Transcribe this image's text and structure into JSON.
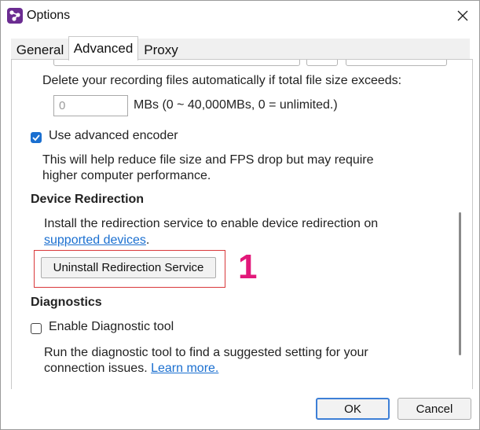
{
  "window": {
    "title": "Options",
    "app_icon": "app-logo-icon",
    "close_icon": "close-icon"
  },
  "tabs": [
    {
      "label": "General",
      "selected": false
    },
    {
      "label": "Advanced",
      "selected": true
    },
    {
      "label": "Proxy",
      "selected": false
    }
  ],
  "recording": {
    "auto_delete_label": "Delete your recording files automatically if total file size exceeds:",
    "size_value": "0",
    "size_hint": "MBs (0 ~ 40,000MBs, 0 = unlimited.)"
  },
  "encoder": {
    "checkbox_label": "Use advanced encoder",
    "checked": true,
    "description_line1": "This will help reduce file size and FPS drop but may require",
    "description_line2": "higher computer performance."
  },
  "device_redirection": {
    "heading": "Device Redirection",
    "description": "Install the redirection service to enable device redirection on",
    "link_text": "supported devices",
    "link_suffix": ".",
    "uninstall_button": "Uninstall Redirection Service"
  },
  "annotation": {
    "marker": "1",
    "color": "#e2187a"
  },
  "diagnostics": {
    "heading": "Diagnostics",
    "checkbox_label": "Enable Diagnostic tool",
    "checked": false,
    "description_line1": "Run the diagnostic tool to find a suggested setting for your",
    "description_line2": "connection issues.",
    "learn_more": "Learn more."
  },
  "footer": {
    "ok_label": "OK",
    "cancel_label": "Cancel"
  }
}
